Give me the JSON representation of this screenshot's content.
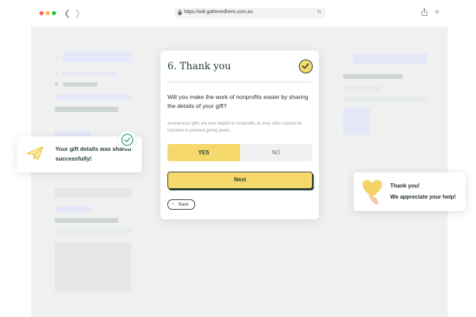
{
  "browser": {
    "url": "https://will.gatheredhere.com.au",
    "traffic_lights": [
      "#ff5f57",
      "#febc2e",
      "#28c840"
    ],
    "icons": [
      "chevron-left-icon",
      "chevron-right-icon",
      "lock-icon",
      "reload-icon",
      "share-icon",
      "plus-icon"
    ]
  },
  "card": {
    "title": "6. Thank you",
    "question": "Will you make the work of nonprofits easier by sharing the details of your gift?",
    "hint": "Anonymous gifts are less helpful to nonprofits as they often cannot be included in planned giving goals.",
    "options": {
      "yes": "YES",
      "no": "NO",
      "selected": "YES"
    },
    "next_label": "Next",
    "back_label": "Back"
  },
  "toast_left": {
    "message": "Your gift details was shared successfully!",
    "icon": "paper-plane-icon"
  },
  "toast_right": {
    "line1": "Thank you!",
    "line2": "We appreciate your help!",
    "icon": "heart-hand-icon"
  },
  "colors": {
    "accent_yellow": "#f5d96b",
    "dark_green": "#1f3a33",
    "success_green": "#2e9c7a",
    "placeholder_blue": "#e4e8f8",
    "placeholder_grey": "#dfe2e4"
  }
}
